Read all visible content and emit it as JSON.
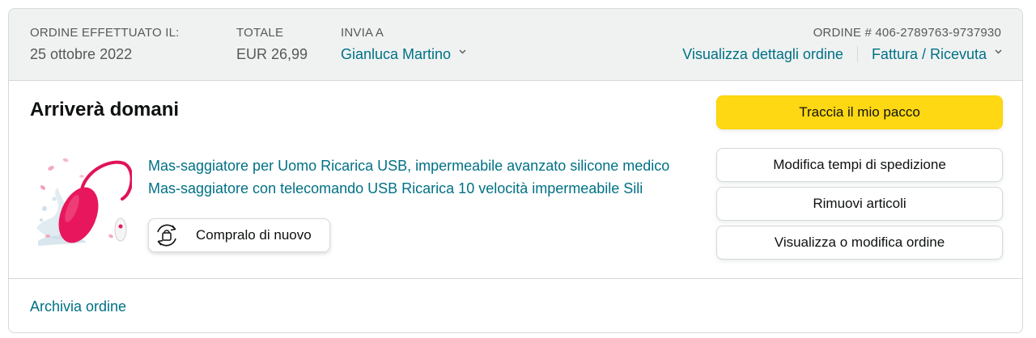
{
  "header": {
    "order_placed_label": "ORDINE EFFETTUATO IL:",
    "order_placed_value": "25 ottobre 2022",
    "total_label": "TOTALE",
    "total_value": "EUR 26,99",
    "ship_to_label": "INVIA A",
    "ship_to_value": "Gianluca Martino",
    "order_number": "ORDINE # 406-2789763-9737930",
    "view_details_link": "Visualizza dettagli ordine",
    "invoice_link": "Fattura / Ricevuta"
  },
  "shipment": {
    "status": "Arriverà domani",
    "product_title": "Mas-saggiatore per Uomo Ricarica USB, impermeabile avanzato silicone medico Mas-saggiatore con telecomando USB Ricarica 10 velocità impermeabile Sili",
    "buy_again_label": "Compralo di nuovo"
  },
  "actions": {
    "track_package": "Traccia il mio pacco",
    "change_delivery": "Modifica tempi di spedizione",
    "remove_items": "Rimuovi articoli",
    "view_edit_order": "Visualizza o modifica ordine"
  },
  "footer": {
    "archive_link": "Archivia ordine"
  },
  "colors": {
    "link": "#007185",
    "primary_button": "#ffd814",
    "header_bg": "#f0f2f2",
    "product_accent": "#e8175d"
  },
  "icons": {
    "ship_to_dropdown": "chevron-down-icon",
    "invoice_dropdown": "chevron-down-icon",
    "buy_again": "buy-again-icon"
  }
}
